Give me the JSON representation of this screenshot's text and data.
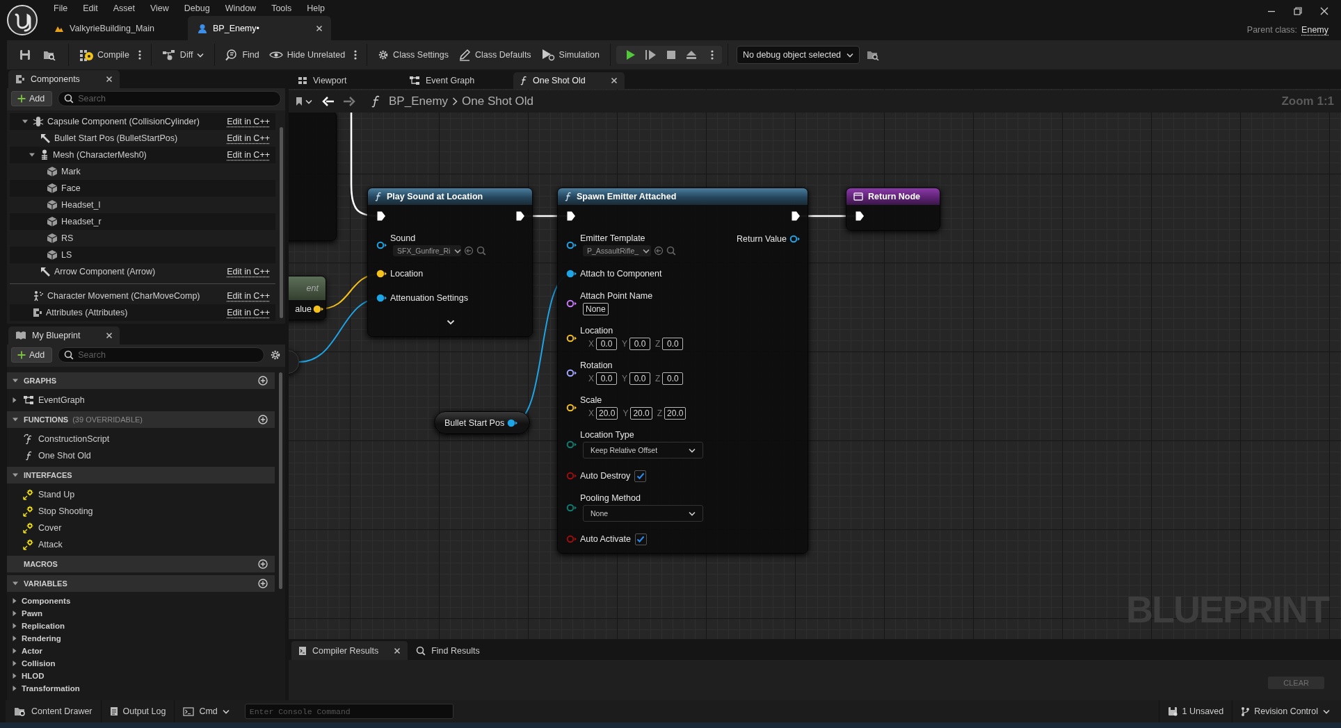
{
  "menu": [
    "File",
    "Edit",
    "Asset",
    "View",
    "Debug",
    "Window",
    "Tools",
    "Help"
  ],
  "document_tabs": [
    {
      "label": "ValkyrieBuilding_Main",
      "kind": "level",
      "selected": false
    },
    {
      "label": "BP_Enemy•",
      "kind": "blueprint",
      "selected": true
    }
  ],
  "parent_class": {
    "label": "Parent class:",
    "value": "Enemy"
  },
  "toolbar": {
    "compile": "Compile",
    "diff": "Diff",
    "find": "Find",
    "hide_unrelated": "Hide Unrelated",
    "class_settings": "Class Settings",
    "class_defaults": "Class Defaults",
    "simulation": "Simulation",
    "debug_object": "No debug object selected"
  },
  "components_panel": {
    "title": "Components",
    "add": "Add",
    "search": {
      "placeholder": "Search"
    },
    "tree": [
      {
        "label": "Capsule Component (CollisionCylinder)",
        "kind": "capsule",
        "link": "Edit in C++",
        "expanded": true,
        "children": [
          {
            "label": "Bullet Start Pos (BulletStartPos)",
            "kind": "arrow",
            "link": "Edit in C++"
          },
          {
            "label": "Mesh (CharacterMesh0)",
            "kind": "skeletal_mesh",
            "link": "Edit in C++",
            "expanded": true,
            "children": [
              {
                "label": "Mark",
                "kind": "static_mesh"
              },
              {
                "label": "Face",
                "kind": "static_mesh"
              },
              {
                "label": "Headset_l",
                "kind": "static_mesh"
              },
              {
                "label": "Headset_r",
                "kind": "static_mesh"
              },
              {
                "label": "RS",
                "kind": "static_mesh"
              },
              {
                "label": "LS",
                "kind": "static_mesh"
              }
            ]
          },
          {
            "label": "Arrow Component (Arrow)",
            "kind": "arrow",
            "link": "Edit in C++"
          }
        ]
      }
    ],
    "other_components": [
      {
        "label": "Character Movement (CharMoveComp)",
        "kind": "movement",
        "link": "Edit in C++"
      },
      {
        "label": "Attributes (Attributes)",
        "kind": "actor_component",
        "link": "Edit in C++"
      }
    ]
  },
  "my_blueprint": {
    "title": "My Blueprint",
    "add": "Add",
    "search": {
      "placeholder": "Search"
    },
    "sections": [
      {
        "title": "GRAPHS",
        "expanded": true,
        "addable": true,
        "items": [
          {
            "label": "EventGraph",
            "kind": "graph",
            "expanded": false
          }
        ]
      },
      {
        "title": "FUNCTIONS",
        "note": "(39 OVERRIDABLE)",
        "expanded": true,
        "addable": true,
        "items": [
          {
            "label": "ConstructionScript",
            "kind": "construction"
          },
          {
            "label": "One Shot Old",
            "kind": "function"
          }
        ]
      },
      {
        "title": "INTERFACES",
        "expanded": true,
        "addable": false,
        "items": [
          {
            "label": "Stand Up",
            "kind": "interface"
          },
          {
            "label": "Stop Shooting",
            "kind": "interface"
          },
          {
            "label": "Cover",
            "kind": "interface"
          },
          {
            "label": "Attack",
            "kind": "interface"
          }
        ]
      },
      {
        "title": "MACROS",
        "addable": true
      },
      {
        "title": "VARIABLES",
        "expanded": true,
        "addable": true,
        "items": [
          {
            "label": "Components",
            "kind": "category",
            "expanded": false
          },
          {
            "label": "Pawn",
            "kind": "category",
            "expanded": false
          },
          {
            "label": "Replication",
            "kind": "category",
            "expanded": false
          },
          {
            "label": "Rendering",
            "kind": "category",
            "expanded": false
          },
          {
            "label": "Actor",
            "kind": "category",
            "expanded": false
          },
          {
            "label": "Collision",
            "kind": "category",
            "expanded": false
          },
          {
            "label": "HLOD",
            "kind": "category",
            "expanded": false
          },
          {
            "label": "Transformation",
            "kind": "category",
            "expanded": false
          }
        ]
      }
    ]
  },
  "graph_tabs": [
    {
      "label": "Viewport",
      "kind": "viewport",
      "selected": false
    },
    {
      "label": "Event Graph",
      "kind": "graph",
      "selected": false
    },
    {
      "label": "One Shot Old",
      "kind": "function",
      "selected": true
    }
  ],
  "breadcrumb": {
    "root": "BP_Enemy",
    "current": "One Shot Old"
  },
  "zoom": "Zoom 1:1",
  "graph_label": "BLUEPRINT",
  "nodes": [
    {
      "kind": "partial_block"
    },
    {
      "kind": "partial",
      "title": "ent",
      "pin": {
        "label": "alue",
        "color": "#f5c21b",
        "connected": true
      }
    },
    {
      "kind": "partial_variable"
    },
    {
      "kind": "function",
      "title": "Play Sound at Location",
      "rows": [
        {
          "kind": "exec",
          "input": true,
          "output": true
        },
        {
          "kind": "pin",
          "label": "Sound",
          "color": "#1ea5e6",
          "connected": false,
          "control": {
            "kind": "asset",
            "value": "SFX_Gunfire_Ri"
          }
        },
        {
          "kind": "pin",
          "label": "Location",
          "color": "#f5c21b",
          "connected": true
        },
        {
          "kind": "pin",
          "label": "Attenuation Settings",
          "color": "#1ea5e6",
          "connected": true
        },
        {
          "kind": "expander"
        }
      ]
    },
    {
      "kind": "function",
      "title": "Spawn Emitter Attached",
      "rows": [
        {
          "kind": "exec",
          "input": true,
          "output": true
        },
        {
          "kind": "pin",
          "label": "Emitter Template",
          "color": "#1ea5e6",
          "connected": false,
          "control": {
            "kind": "asset",
            "value": "P_AssaultRifle_"
          },
          "output": {
            "label": "Return Value",
            "color": "#1ea5e6",
            "connected": false
          }
        },
        {
          "kind": "pin",
          "label": "Attach to Component",
          "color": "#1ea5e6",
          "connected": true
        },
        {
          "kind": "pin",
          "label": "Attach Point Name",
          "color": "#c97bff",
          "connected": false,
          "control": {
            "kind": "text",
            "value": "None"
          }
        },
        {
          "kind": "pin",
          "label": "Location",
          "color": "#f5c21b",
          "connected": false,
          "control": {
            "kind": "vector",
            "fields": [
              {
                "axis": "X",
                "value": "0.0"
              },
              {
                "axis": "Y",
                "value": "0.0"
              },
              {
                "axis": "Z",
                "value": "0.0"
              }
            ]
          }
        },
        {
          "kind": "pin",
          "label": "Rotation",
          "color": "#a4a6ff",
          "connected": false,
          "control": {
            "kind": "vector",
            "fields": [
              {
                "axis": "X",
                "value": "0.0"
              },
              {
                "axis": "Y",
                "value": "0.0"
              },
              {
                "axis": "Z",
                "value": "0.0"
              }
            ]
          }
        },
        {
          "kind": "pin",
          "label": "Scale",
          "color": "#f5c21b",
          "connected": false,
          "control": {
            "kind": "vector",
            "fields": [
              {
                "axis": "X",
                "value": "20.0"
              },
              {
                "axis": "Y",
                "value": "20.0"
              },
              {
                "axis": "Z",
                "value": "20.0"
              }
            ]
          }
        },
        {
          "kind": "pin",
          "label": "Location Type",
          "color": "#0b7f73",
          "connected": false,
          "control": {
            "kind": "enum",
            "value": "Keep Relative Offset"
          }
        },
        {
          "kind": "pin",
          "label": "Auto Destroy",
          "color": "#a00d0d",
          "connected": false,
          "control": {
            "kind": "checkbox",
            "checked": true
          }
        },
        {
          "kind": "pin",
          "label": "Pooling Method",
          "color": "#0b7f73",
          "connected": false,
          "control": {
            "kind": "enum",
            "value": "None"
          }
        },
        {
          "kind": "pin",
          "label": "Auto Activate",
          "color": "#a00d0d",
          "connected": false,
          "control": {
            "kind": "checkbox",
            "checked": true
          }
        }
      ]
    },
    {
      "kind": "return",
      "title": "Return Node",
      "rows": [
        {
          "kind": "exec",
          "input": true,
          "output": false
        }
      ]
    },
    {
      "kind": "variable",
      "label": "Bullet Start Pos",
      "pin": {
        "color": "#1ea5e6",
        "connected": true
      }
    }
  ],
  "bottom_panel": {
    "tabs": [
      {
        "label": "Compiler Results",
        "kind": "log",
        "selected": true
      },
      {
        "label": "Find Results",
        "kind": "search",
        "selected": false
      }
    ],
    "clear": {
      "label": "CLEAR",
      "disabled": true
    }
  },
  "status_bar": {
    "content_drawer": "Content Drawer",
    "output_log": "Output Log",
    "cmd": "Cmd",
    "console": {
      "placeholder": "Enter Console Command"
    },
    "unsaved": "1 Unsaved",
    "revision_control": "Revision Control"
  }
}
